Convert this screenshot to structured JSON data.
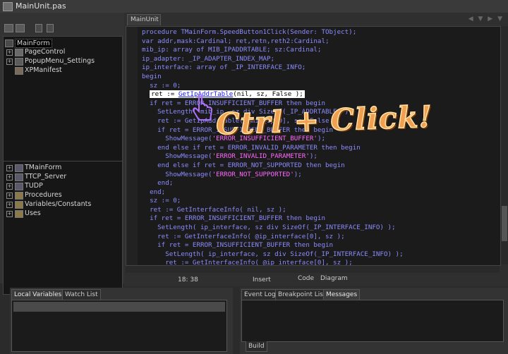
{
  "window": {
    "title": "MainUnit.pas"
  },
  "left": {
    "tree_top": [
      {
        "label": "MainForm",
        "expanded": false,
        "selected": true
      },
      {
        "label": "PageControl",
        "expanded": true
      },
      {
        "label": "PopupMenu_Settings",
        "expanded": true
      },
      {
        "label": "XPManifest",
        "expanded": false
      }
    ],
    "tree_bottom": [
      {
        "label": "TMainForm"
      },
      {
        "label": "TTCP_Server"
      },
      {
        "label": "TUDP"
      },
      {
        "label": "Procedures"
      },
      {
        "label": "Variables/Constants"
      },
      {
        "label": "Uses"
      }
    ]
  },
  "editor": {
    "tab_label": "MainUnit",
    "status_position": "18:  38",
    "status_mode": "Insert",
    "tab_code": "Code",
    "tab_diagram": "Diagram",
    "overlay_text": "Ctrl + Click!",
    "code_lines": [
      "procedure TMainForm.SpeedButton1Click(Sender: TObject);",
      "var addr,mask:Cardinal; ret,retn,reth2:Cardinal;",
      "mib_ip: array of MIB_IPADDRTABLE; sz:Cardinal;",
      "ip_adapter: _IP_ADAPTER_INDEX_MAP;",
      "ip_interface: array of _IP_INTERFACE_INFO;",
      "begin",
      "  sz := 0;",
      "  ret := GetIpAddrTable(nil, sz, False );",
      "  if ret = ERROR_INSUFFICIENT_BUFFER then begin",
      "    SetLength( mib_ip, sz div SizeOf(_IP_ADDRTABLE) );",
      "    ret := GetIpAddrTable( @mib_ip[0], sz, False );",
      "    if ret = ERROR_INSUFFICIENT_BUFFER then begin",
      "      ShowMessage('ERROR_INSUFFICIENT_BUFFER');",
      "    end else if ret = ERROR_INVALID_PARAMETER then begin",
      "      ShowMessage('ERROR_INVALID_PARAMETER');",
      "    end else if ret = ERROR_NOT_SUPPORTED then begin",
      "      ShowMessage('ERROR_NOT_SUPPORTED');",
      "    end;",
      "  end;",
      "  sz := 0;",
      "  ret := GetInterfaceInfo( nil, sz );",
      "  if ret = ERROR_INSUFFICIENT_BUFFER then begin",
      "    SetLength( ip_interface, sz div SizeOf(_IP_INTERFACE_INFO) );",
      "    ret := GetInterfaceInfo( @ip_interface[0], sz );",
      "    if ret = ERROR_INSUFFICIENT_BUFFER then begin",
      "      SetLength( ip_interface, sz div SizeOf(_IP_INTERFACE_INFO) );",
      "      ret := GetInterfaceInfo( @ip_interface[0], sz );"
    ]
  },
  "bottom": {
    "left_tabs": [
      "Local Variables",
      "Watch List"
    ],
    "right_tabs": [
      "Event Log",
      "Breakpoint List",
      "Messages"
    ],
    "build_tab": "Build"
  },
  "colors": {
    "keyword": "#8c8cff",
    "string": "#ff6aff",
    "overlay": "#f0a050",
    "link": "#1a1aff"
  }
}
